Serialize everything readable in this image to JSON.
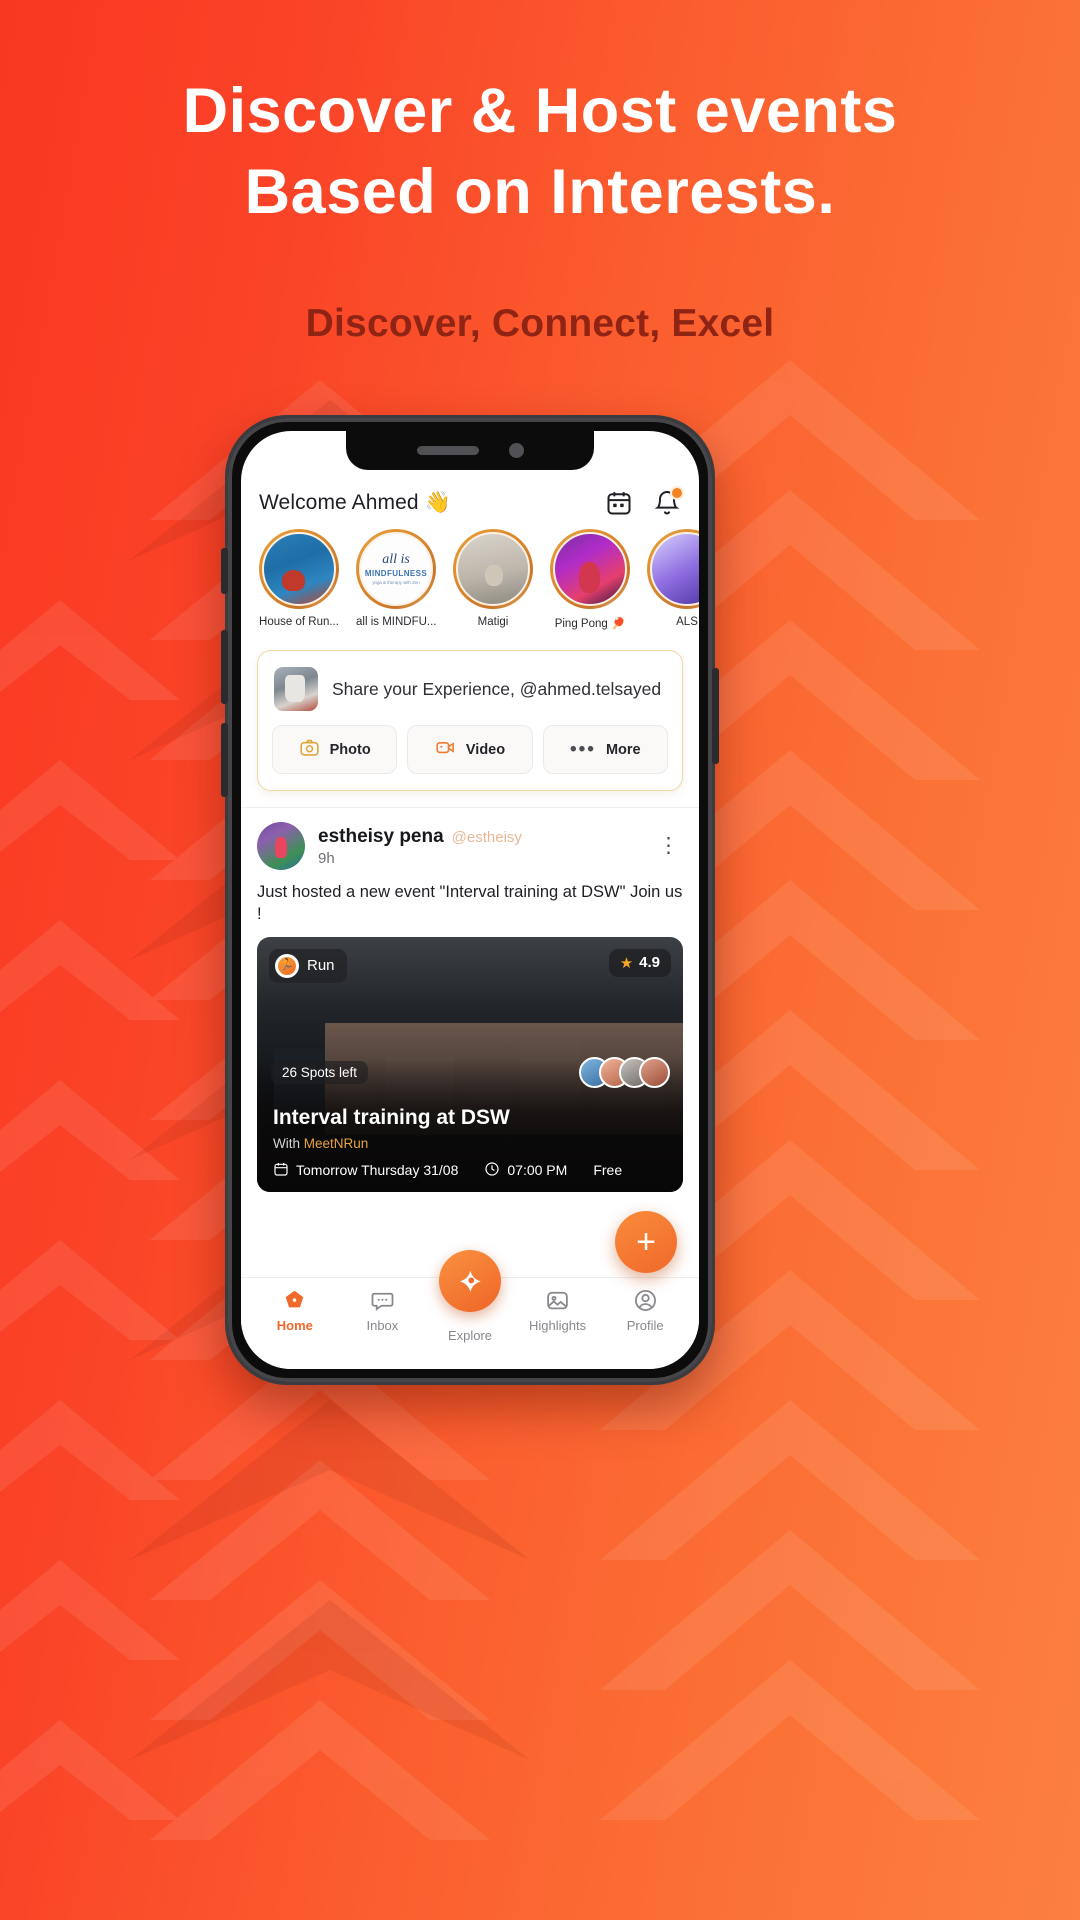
{
  "promo": {
    "headline_line1": "Discover & Host events",
    "headline_line2": "Based on Interests.",
    "subheadline": "Discover, Connect, Excel",
    "colors": {
      "bg_start": "#f93822",
      "bg_end": "#fc8040",
      "subhead": "#8f2414",
      "accent": "#f0682a"
    }
  },
  "app": {
    "header": {
      "welcome": "Welcome Ahmed 👋",
      "calendar_icon": "calendar-icon",
      "notification_icon": "bell-icon"
    },
    "stories": [
      {
        "name": "House of Run...",
        "avatar": "house-of-run-avatar"
      },
      {
        "name": "all is MINDFU...",
        "avatar": "all-is-mindfulness-avatar",
        "logo_line1": "all is",
        "logo_line2": "MINDFULNESS",
        "logo_line3": "yoga & therapy with Zen"
      },
      {
        "name": "Matigi",
        "avatar": "matigi-avatar"
      },
      {
        "name": "Ping Pong 🏓",
        "avatar": "ping-pong-avatar"
      },
      {
        "name": "ALS",
        "avatar": "als-avatar"
      }
    ],
    "composer": {
      "avatar": "user-avatar",
      "prompt": "Share your Experience, @ahmed.telsayed",
      "actions": [
        {
          "label": "Photo",
          "icon": "camera-icon"
        },
        {
          "label": "Video",
          "icon": "video-icon"
        },
        {
          "label": "More",
          "icon": "ellipsis-icon"
        }
      ]
    },
    "post": {
      "author_name": "estheisy pena",
      "author_handle": "@estheisy",
      "timestamp": "9h",
      "menu_icon": "kebab-menu-icon",
      "body": "Just hosted a new event \"Interval training at DSW\" Join us !",
      "event": {
        "category": "Run",
        "category_icon": "runner-icon",
        "rating": "4.9",
        "rating_icon": "star-icon",
        "spots_left": "26 Spots left",
        "title": "Interval training at DSW",
        "with_prefix": "With",
        "with_org": "MeetNRun",
        "date": "Tomorrow Thursday 31/08",
        "date_icon": "calendar-icon",
        "time": "07:00 PM",
        "time_icon": "clock-icon",
        "price": "Free",
        "attendees_count": 4
      }
    },
    "fab": {
      "label": "+",
      "name": "create-button"
    },
    "tabs": [
      {
        "label": "Home",
        "icon": "home-icon",
        "active": true
      },
      {
        "label": "Inbox",
        "icon": "chat-icon",
        "active": false
      },
      {
        "label": "Explore",
        "icon": "compass-icon",
        "active": false
      },
      {
        "label": "Highlights",
        "icon": "image-icon",
        "active": false
      },
      {
        "label": "Profile",
        "icon": "person-icon",
        "active": false
      }
    ]
  }
}
